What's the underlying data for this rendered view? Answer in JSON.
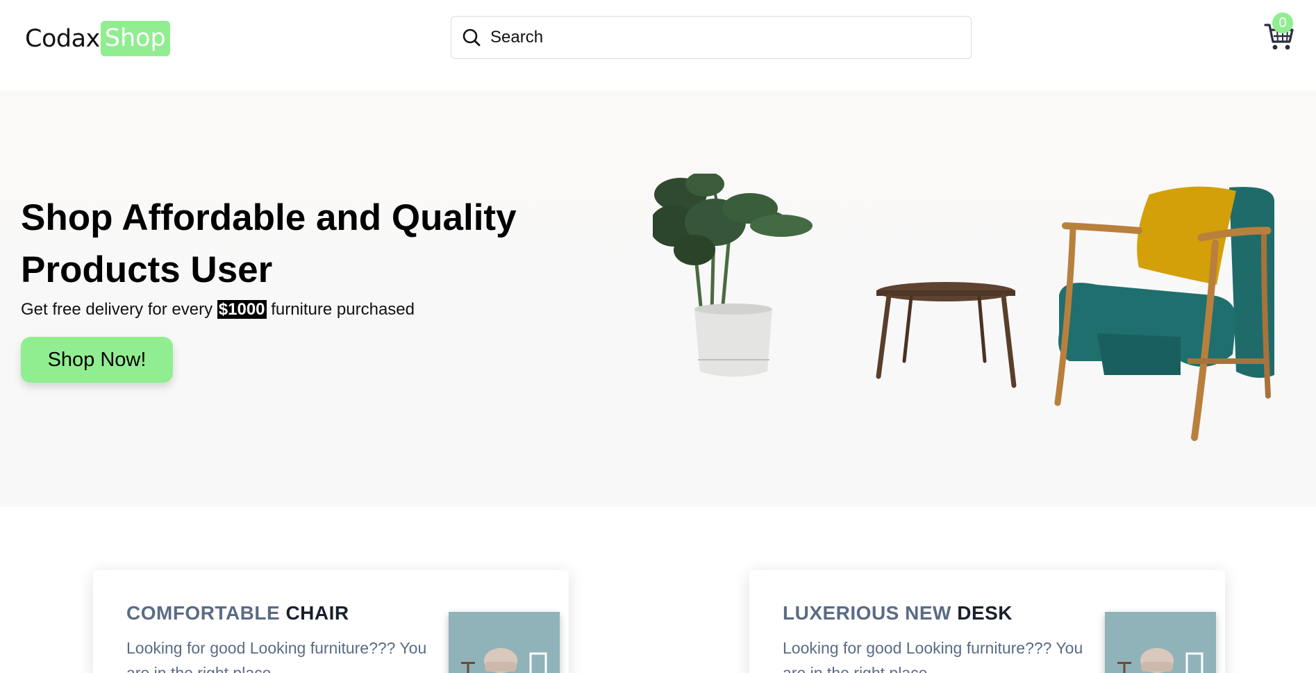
{
  "header": {
    "logo_part1": "Codax",
    "logo_part2": "Shop",
    "search_placeholder": "Search",
    "cart_count": "0"
  },
  "hero": {
    "title": "Shop Affordable and Quality Products User",
    "subtitle_before": "Get free delivery for every ",
    "subtitle_highlight": "$1000",
    "subtitle_after": " furniture purchased",
    "cta_label": "Shop Now!"
  },
  "cards": [
    {
      "title_part1": "COMFORTABLE ",
      "title_part2": "CHAIR",
      "text": "Looking for good Looking furniture??? You are in the right place"
    },
    {
      "title_part1": "LUXERIOUS NEW ",
      "title_part2": "DESK",
      "text": "Looking for good Looking furniture??? You are in the right place"
    }
  ],
  "icons": {
    "search": "search-icon",
    "cart": "cart-icon"
  },
  "colors": {
    "accent": "#90ee90",
    "card_title_muted": "#5a6b85",
    "card_title_dark": "#1a1f2e"
  }
}
